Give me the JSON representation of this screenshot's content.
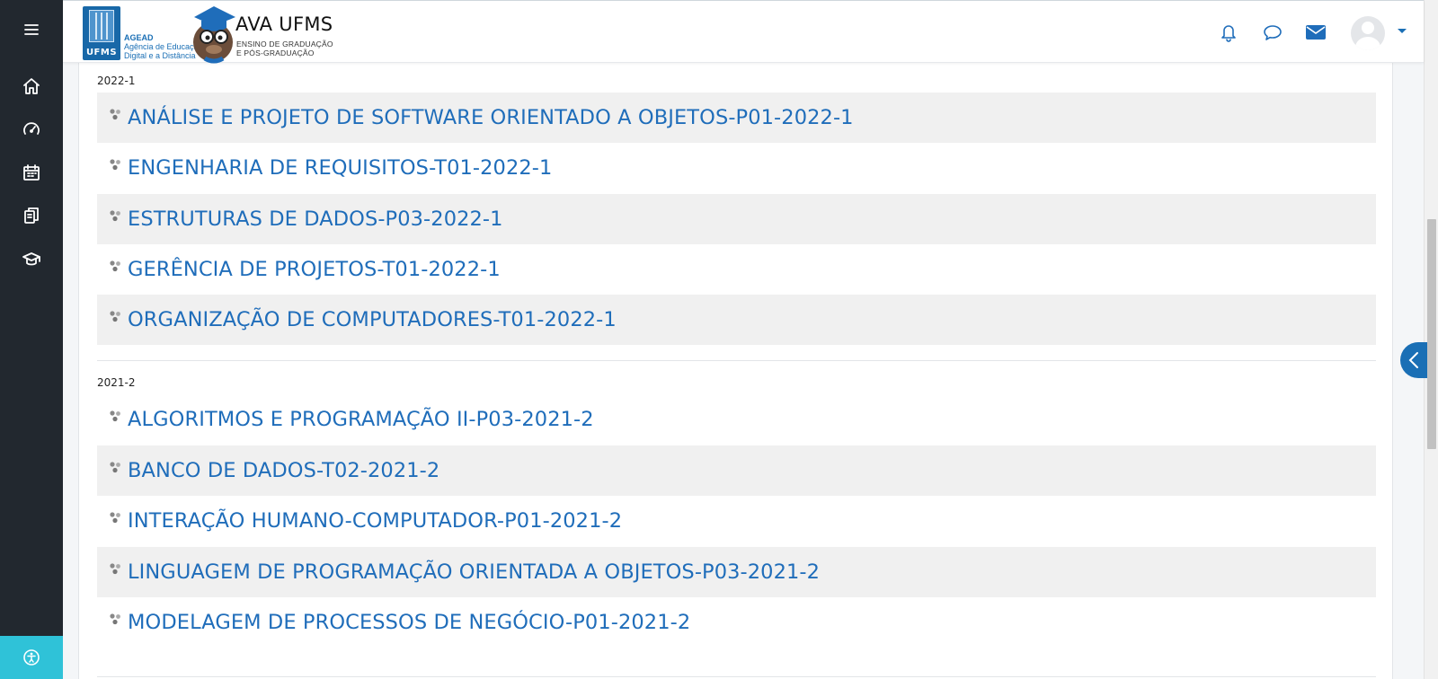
{
  "header": {
    "logo_text": "UFMS",
    "agency_abbr": "AGEAD",
    "agency_line1": "Agência de Educação",
    "agency_line2": "Digital e a Distância",
    "site_title": "AVA UFMS",
    "site_subtitle_line1": "ENSINO DE GRADUAÇÃO",
    "site_subtitle_line2": "E PÓS-GRADUAÇÃO",
    "icons": [
      "bell-icon",
      "chat-icon",
      "envelope-icon",
      "user-avatar",
      "caret-down-icon"
    ]
  },
  "sidebar": {
    "items": [
      {
        "icon": "menu-icon"
      },
      {
        "icon": "home-icon"
      },
      {
        "icon": "dashboard-icon"
      },
      {
        "icon": "calendar-icon"
      },
      {
        "icon": "files-icon"
      },
      {
        "icon": "graduation-cap-icon"
      }
    ],
    "accessibility_icon": "accessibility-icon"
  },
  "groups": [
    {
      "label": "2022-1",
      "courses": [
        "ANÁLISE E PROJETO DE SOFTWARE ORIENTADO A OBJETOS-P01-2022-1",
        "ENGENHARIA DE REQUISITOS-T01-2022-1",
        "ESTRUTURAS DE DADOS-P03-2022-1",
        "GERÊNCIA DE PROJETOS-T01-2022-1",
        "ORGANIZAÇÃO DE COMPUTADORES-T01-2022-1"
      ]
    },
    {
      "label": "2021-2",
      "courses": [
        "ALGORITMOS E PROGRAMAÇÃO II-P03-2021-2",
        "BANCO DE DADOS-T02-2021-2",
        "INTERAÇÃO HUMANO-COMPUTADOR-P01-2021-2",
        "LINGUAGEM DE PROGRAMAÇÃO ORIENTADA A OBJETOS-P03-2021-2",
        "MODELAGEM DE PROCESSOS DE NEGÓCIO-P01-2021-2"
      ]
    }
  ],
  "colors": {
    "sidebar_bg": "#22282f",
    "accent_blue": "#1f6dba",
    "accessibility_bg": "#2fc2d8",
    "row_shade": "#f0f0f0"
  }
}
